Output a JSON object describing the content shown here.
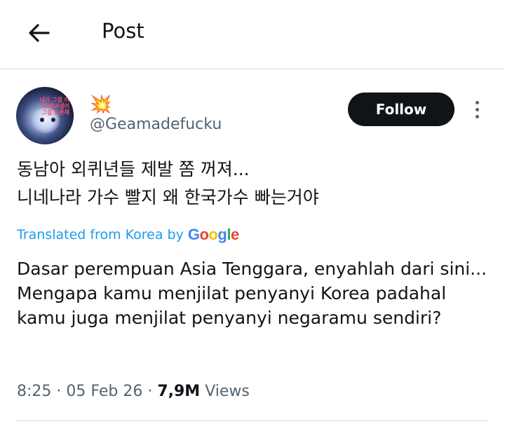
{
  "header": {
    "title": "Post"
  },
  "post": {
    "author_emoji": "💥",
    "author_handle": "@Geamadefucku",
    "avatar_text": "내가 그걸 이제 알아냈어 그걸 모른채",
    "follow_label": "Follow",
    "original_text_line1": "동남아 외퀴년들 제발 쫌 꺼져...",
    "original_text_line2": "니네나라 가수 빨지 왜 한국가수 빠는거야",
    "translated_from_label": "Translated from Korea by",
    "translation_line1": "Dasar perempuan Asia Tenggara, enyahlah dari sini...",
    "translation_line2": "Mengapa kamu menjilat penyanyi Korea padahal kamu juga menjilat penyanyi negaramu sendiri?",
    "time": "8:25",
    "date": "05 Feb 26",
    "views_count": "7,9M",
    "views_label": "Views"
  },
  "colors": {
    "accent": "#1d9bf0",
    "text_primary": "#0f1419",
    "text_secondary": "#536471",
    "divider": "#cfd9de",
    "follow_bg": "#0f1419"
  },
  "icons": {
    "back": "arrow-left-icon",
    "more": "more-vertical-icon"
  }
}
